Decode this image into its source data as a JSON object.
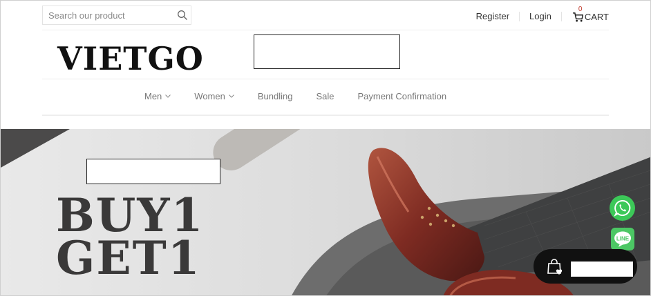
{
  "search": {
    "placeholder": "Search our product",
    "icon": "search-icon"
  },
  "header_links": {
    "register": "Register",
    "login": "Login"
  },
  "cart": {
    "count": "0",
    "label": "CART"
  },
  "logo": {
    "text": "VIETGO"
  },
  "nav": {
    "items": [
      {
        "label": "Men",
        "has_dropdown": true
      },
      {
        "label": "Women",
        "has_dropdown": true
      },
      {
        "label": "Bundling",
        "has_dropdown": false
      },
      {
        "label": "Sale",
        "has_dropdown": false
      },
      {
        "label": "Payment Confirmation",
        "has_dropdown": false
      }
    ]
  },
  "hero": {
    "line1": "BUY1",
    "line2": "GET1"
  },
  "floating": {
    "whatsapp_icon": "whatsapp-icon",
    "line_icon": "line-icon",
    "line_text": "LINE",
    "wishlist_icon": "shopping-bag-heart-icon"
  },
  "colors": {
    "whatsapp": "#3cc858",
    "line": "#4cc764",
    "promo_text": "#3a3939",
    "cart_count": "#c0392b"
  }
}
